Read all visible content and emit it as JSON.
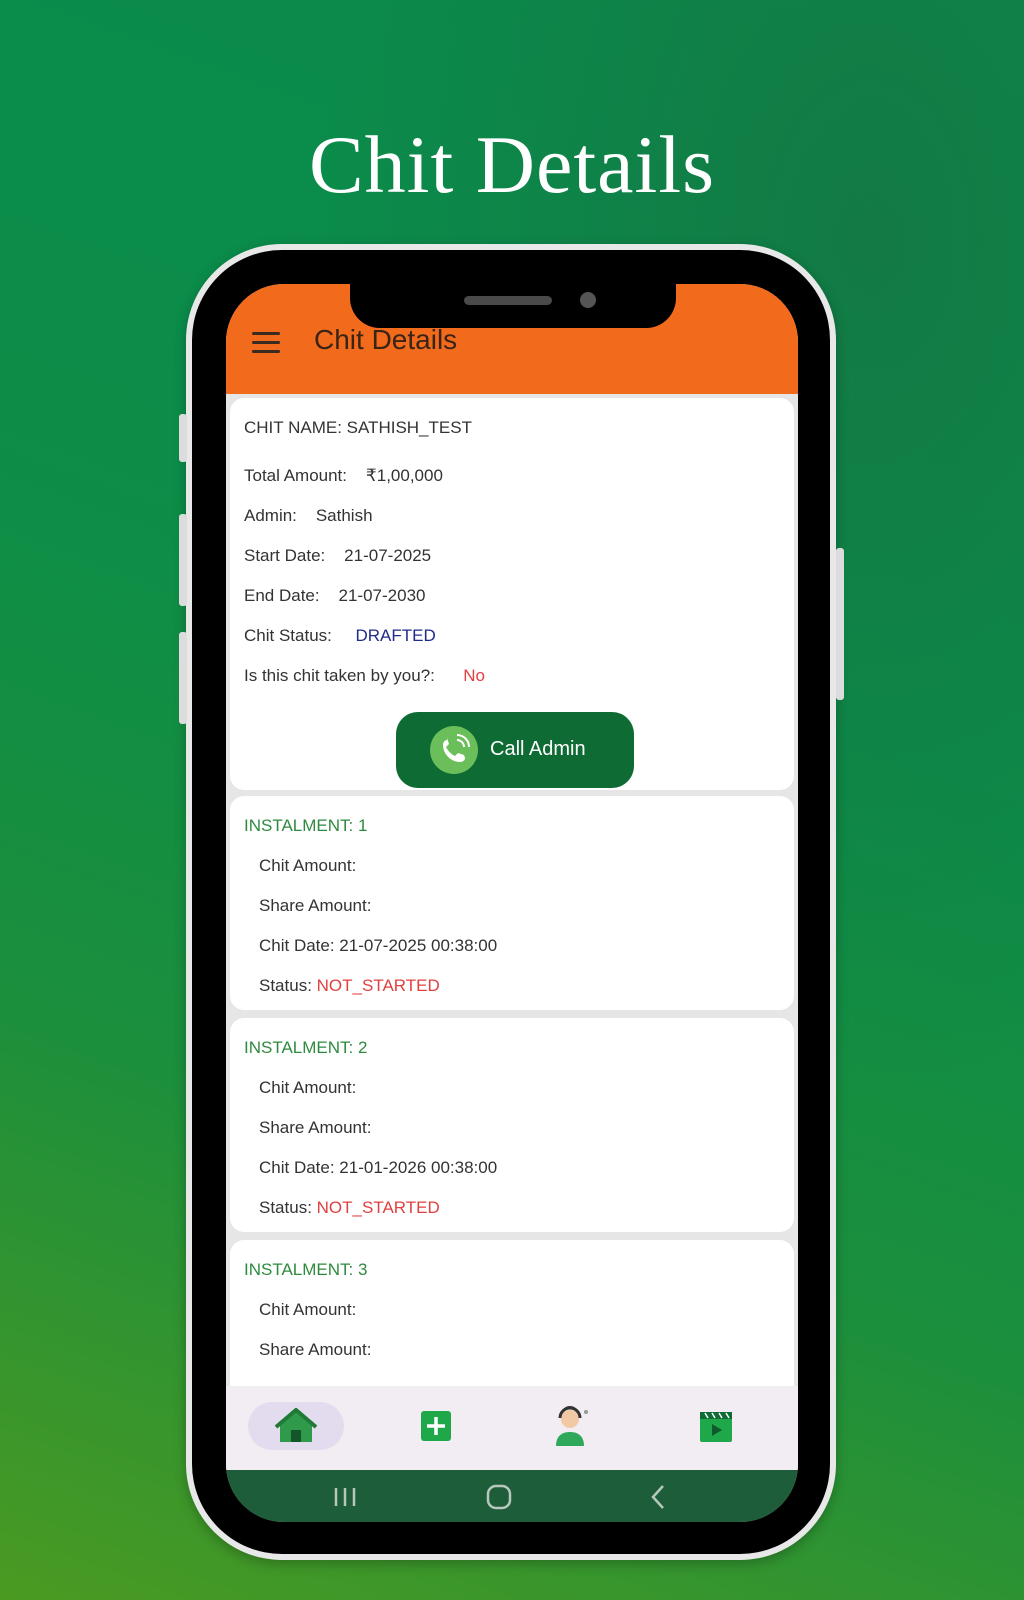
{
  "promo": {
    "headline": "Chit Details"
  },
  "app_bar": {
    "title": "Chit Details"
  },
  "chit_info": {
    "name_line": "CHIT NAME: SATHISH_TEST",
    "total_amount_label": "Total Amount:",
    "total_amount_value": "₹1,00,000",
    "admin_label": "Admin:",
    "admin_value": "Sathish",
    "start_date_label": "Start Date:",
    "start_date_value": "21-07-2025",
    "end_date_label": "End Date:",
    "end_date_value": "21-07-2030",
    "status_label": "Chit Status:",
    "status_value": "DRAFTED",
    "taken_label": "Is this chit taken by you?:",
    "taken_value": "No",
    "call_button_label": "Call Admin"
  },
  "instalments": [
    {
      "title": "INSTALMENT:  1",
      "chit_amount_label": "Chit Amount:",
      "share_amount_label": "Share Amount:",
      "chit_date": "Chit Date: 21-07-2025 00:38:00",
      "status_label": "Status:",
      "status_value": "NOT_STARTED"
    },
    {
      "title": "INSTALMENT:  2",
      "chit_amount_label": "Chit Amount:",
      "share_amount_label": "Share Amount:",
      "chit_date": "Chit Date: 21-01-2026 00:38:00",
      "status_label": "Status:",
      "status_value": "NOT_STARTED"
    },
    {
      "title": "INSTALMENT:  3",
      "chit_amount_label": "Chit Amount:",
      "share_amount_label": "Share Amount:"
    }
  ],
  "bottom_nav": {
    "items": [
      "home-icon",
      "add-icon",
      "support-agent-icon",
      "video-icon"
    ],
    "active": "home-icon"
  },
  "system_nav": {
    "items": [
      "recents-icon",
      "home-circle-icon",
      "back-icon"
    ]
  },
  "colors": {
    "app_bar": "#f26a1b",
    "call_button": "#0f6b34",
    "instalment_title": "#2e8a3e",
    "status_not_started": "#e04040",
    "status_drafted": "#1f2a8a"
  }
}
